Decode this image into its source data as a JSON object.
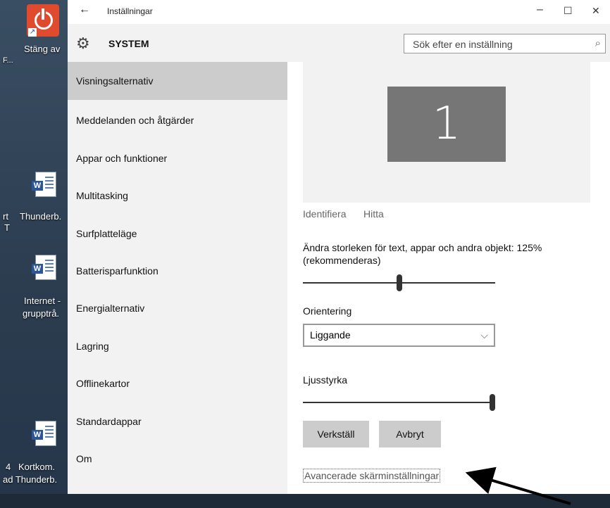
{
  "desktop": {
    "icons": [
      {
        "name": "power-shortcut",
        "label": "Stäng av"
      },
      {
        "name": "word-doc-1",
        "label": "Thunderb."
      },
      {
        "name": "word-doc-2",
        "label": "Internet -"
      },
      {
        "name": "word-doc-2-line2",
        "label": "grupptrå."
      },
      {
        "name": "word-doc-3",
        "label": "Kortkom."
      },
      {
        "name": "word-doc-3-line2",
        "label": "ad Thunderb."
      },
      {
        "name": "partial-1",
        "label": "rt"
      },
      {
        "name": "partial-2",
        "label": "T"
      },
      {
        "name": "partial-3",
        "label": "4"
      },
      {
        "name": "partial-4",
        "label": "F..."
      }
    ]
  },
  "window": {
    "title": "Inställningar",
    "back_icon": "←",
    "minimize": "–",
    "maximize": "☐",
    "close": "✕"
  },
  "header": {
    "section": "SYSTEM",
    "search_placeholder": "Sök efter en inställning",
    "search_icon": "⌕"
  },
  "sidebar": {
    "items": [
      {
        "label": "Visningsalternativ",
        "active": true
      },
      {
        "label": "Meddelanden och åtgärder"
      },
      {
        "label": "Appar och funktioner"
      },
      {
        "label": "Multitasking"
      },
      {
        "label": "Surfplatteläge"
      },
      {
        "label": "Batterisparfunktion"
      },
      {
        "label": "Energialternativ"
      },
      {
        "label": "Lagring"
      },
      {
        "label": "Offlinekartor"
      },
      {
        "label": "Standardappar"
      },
      {
        "label": "Om"
      }
    ]
  },
  "main": {
    "monitor_number": "1",
    "identify_link": "Identifiera",
    "detect_link": "Hitta",
    "scale_label": "Ändra storleken för text, appar och andra objekt: 125%",
    "scale_label2": "(rekommenderas)",
    "scale_value": 0.5,
    "orientation_label": "Orientering",
    "orientation_value": "Liggande",
    "brightness_label": "Ljusstyrka",
    "brightness_value": 1.0,
    "apply_button": "Verkställ",
    "cancel_button": "Avbryt",
    "advanced_link": "Avancerade skärminställningar"
  }
}
